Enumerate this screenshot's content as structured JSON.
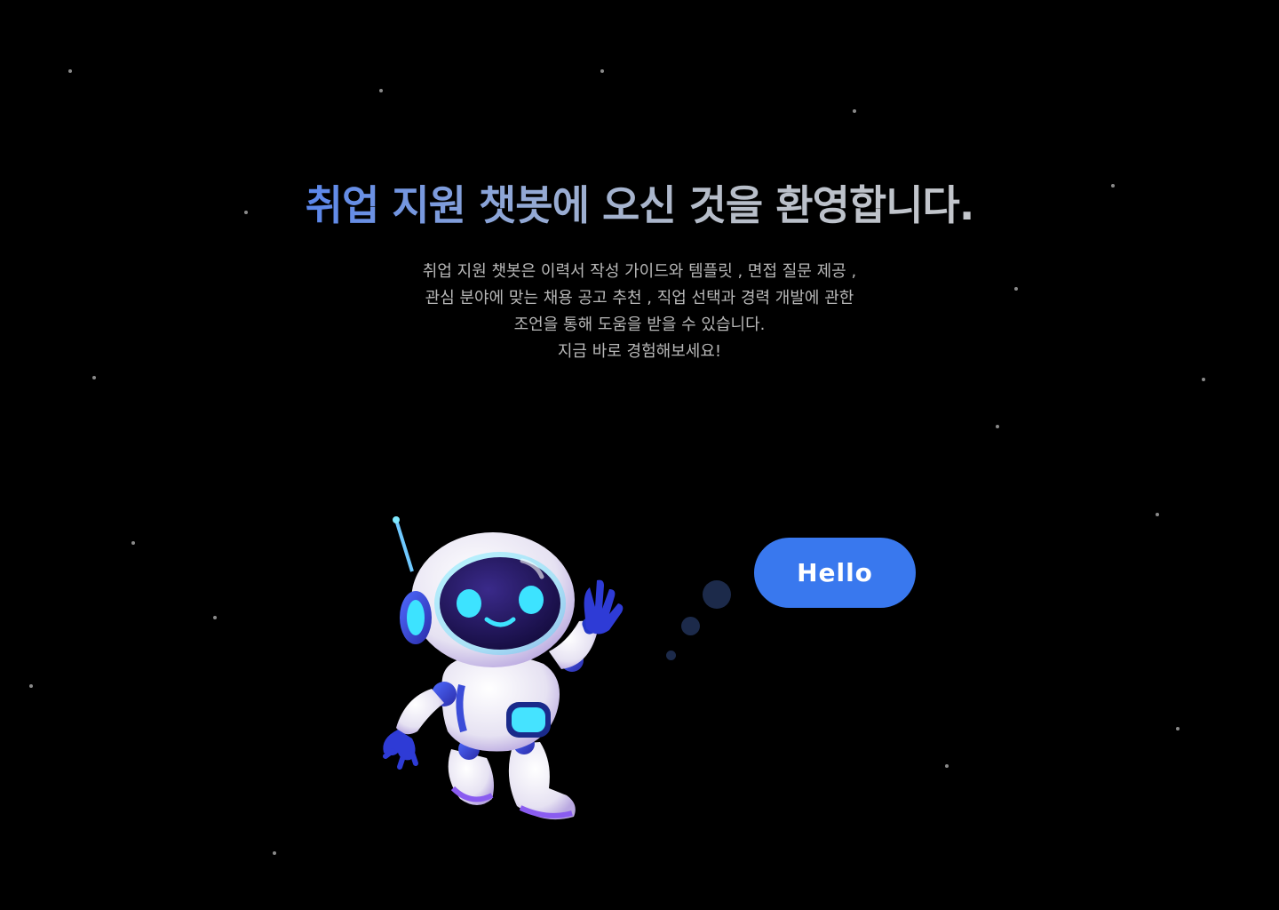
{
  "hero": {
    "title": "취업 지원 챗봇에 오신 것을 환영합니다.",
    "description_lines": [
      "취업 지원 챗봇은 이력서 작성 가이드와 템플릿 , 면접 질문 제공 ,",
      "관심 분야에 맞는 채용 공고 추천 , 직업 선택과 경력 개발에 관한",
      "조언을 통해 도움을 받을 수 있습니다.",
      "지금 바로 경험해보세요!"
    ]
  },
  "chat": {
    "greeting_label": "Hello"
  },
  "mascot": {
    "icon": "robot-mascot-icon"
  },
  "colors": {
    "background": "#000000",
    "accent": "#3978ee",
    "title_gradient_start": "#5a86ea",
    "title_gradient_end": "#c4c7cc",
    "body_text": "#b8b8b8"
  }
}
